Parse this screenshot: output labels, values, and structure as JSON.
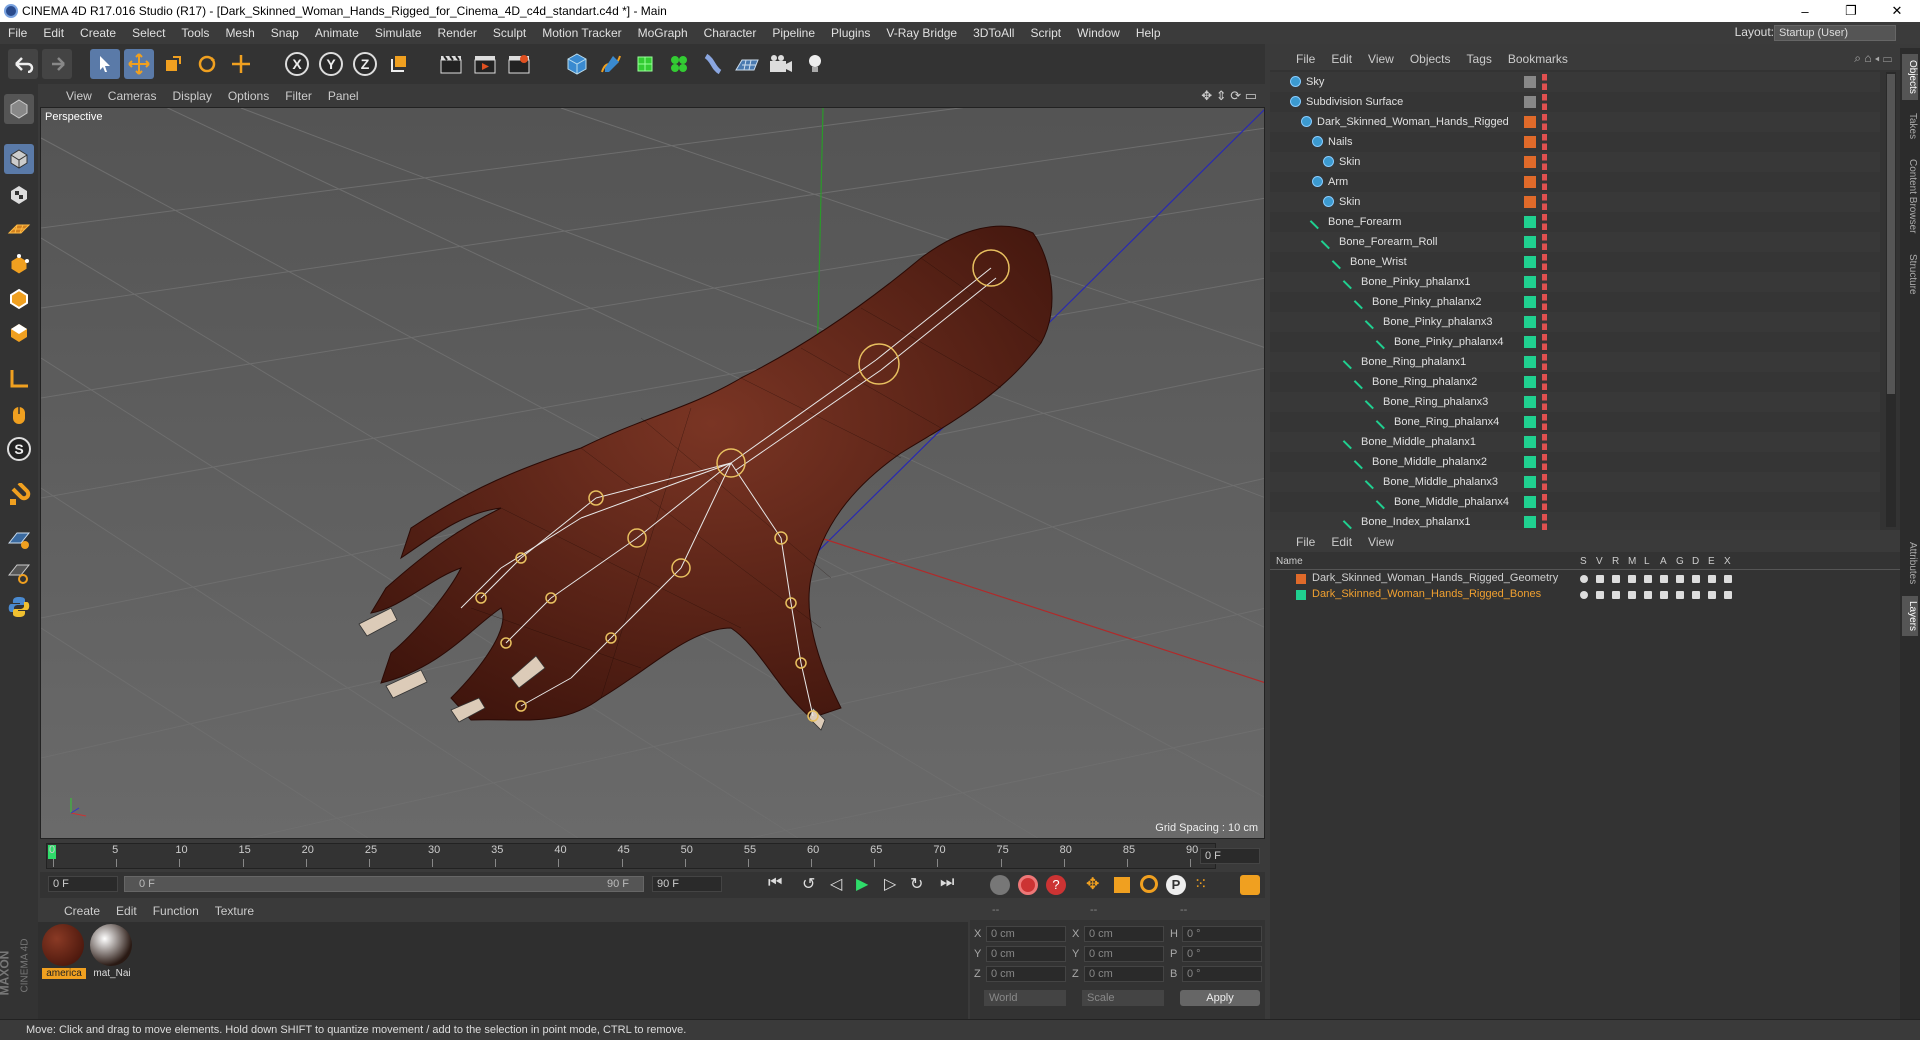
{
  "window": {
    "title": "CINEMA 4D R17.016 Studio (R17) - [Dark_Skinned_Woman_Hands_Rigged_for_Cinema_4D_c4d_standart.c4d *] - Main",
    "minimize": "–",
    "maximize": "❐",
    "close": "✕"
  },
  "menu": [
    "File",
    "Edit",
    "Create",
    "Select",
    "Tools",
    "Mesh",
    "Snap",
    "Animate",
    "Simulate",
    "Render",
    "Sculpt",
    "Motion Tracker",
    "MoGraph",
    "Character",
    "Pipeline",
    "Plugins",
    "V-Ray Bridge",
    "3DToAll",
    "Script",
    "Window",
    "Help"
  ],
  "layout": {
    "label": "Layout:",
    "value": "Startup (User)"
  },
  "viewport": {
    "menu": [
      "View",
      "Cameras",
      "Display",
      "Options",
      "Filter",
      "Panel"
    ],
    "label": "Perspective",
    "grid_spacing": "Grid Spacing : 10 cm"
  },
  "timeline": {
    "ticks": [
      "0",
      "5",
      "10",
      "15",
      "20",
      "25",
      "30",
      "35",
      "40",
      "45",
      "50",
      "55",
      "60",
      "65",
      "70",
      "75",
      "80",
      "85",
      "90"
    ],
    "current": "0 F",
    "start": "0 F",
    "range_start": "0 F",
    "range_end": "90 F",
    "end": "90 F"
  },
  "material_manager": {
    "menu": [
      "Create",
      "Edit",
      "Function",
      "Texture"
    ],
    "materials": [
      {
        "name": "america",
        "color": "#5a1e12"
      },
      {
        "name": "mat_Nai",
        "color": "#e8e0d8"
      }
    ]
  },
  "coordinates": {
    "header": [
      "--",
      "--",
      "--"
    ],
    "rows": [
      {
        "a": "X",
        "av": "0 cm",
        "b": "X",
        "bv": "0 cm",
        "c": "H",
        "cv": "0 °"
      },
      {
        "a": "Y",
        "av": "0 cm",
        "b": "Y",
        "bv": "0 cm",
        "c": "P",
        "cv": "0 °"
      },
      {
        "a": "Z",
        "av": "0 cm",
        "b": "Z",
        "bv": "0 cm",
        "c": "B",
        "cv": "0 °"
      }
    ],
    "world": "World",
    "scale": "Scale",
    "apply": "Apply"
  },
  "object_manager": {
    "menu": [
      "File",
      "Edit",
      "View",
      "Objects",
      "Tags",
      "Bookmarks"
    ],
    "objects": [
      {
        "name": "Sky",
        "indent": 0,
        "color": "#888888"
      },
      {
        "name": "Subdivision Surface",
        "indent": 0,
        "color": "#888888"
      },
      {
        "name": "Dark_Skinned_Woman_Hands_Rigged",
        "indent": 1,
        "color": "#e06a2a"
      },
      {
        "name": "Nails",
        "indent": 2,
        "color": "#e06a2a"
      },
      {
        "name": "Skin",
        "indent": 3,
        "color": "#e06a2a"
      },
      {
        "name": "Arm",
        "indent": 2,
        "color": "#e06a2a"
      },
      {
        "name": "Skin",
        "indent": 3,
        "color": "#e06a2a"
      },
      {
        "name": "Bone_Forearm",
        "indent": 2,
        "color": "#20d090"
      },
      {
        "name": "Bone_Forearm_Roll",
        "indent": 3,
        "color": "#20d090"
      },
      {
        "name": "Bone_Wrist",
        "indent": 4,
        "color": "#20d090"
      },
      {
        "name": "Bone_Pinky_phalanx1",
        "indent": 5,
        "color": "#20d090"
      },
      {
        "name": "Bone_Pinky_phalanx2",
        "indent": 6,
        "color": "#20d090"
      },
      {
        "name": "Bone_Pinky_phalanx3",
        "indent": 7,
        "color": "#20d090"
      },
      {
        "name": "Bone_Pinky_phalanx4",
        "indent": 8,
        "color": "#20d090"
      },
      {
        "name": "Bone_Ring_phalanx1",
        "indent": 5,
        "color": "#20d090"
      },
      {
        "name": "Bone_Ring_phalanx2",
        "indent": 6,
        "color": "#20d090"
      },
      {
        "name": "Bone_Ring_phalanx3",
        "indent": 7,
        "color": "#20d090"
      },
      {
        "name": "Bone_Ring_phalanx4",
        "indent": 8,
        "color": "#20d090"
      },
      {
        "name": "Bone_Middle_phalanx1",
        "indent": 5,
        "color": "#20d090"
      },
      {
        "name": "Bone_Middle_phalanx2",
        "indent": 6,
        "color": "#20d090"
      },
      {
        "name": "Bone_Middle_phalanx3",
        "indent": 7,
        "color": "#20d090"
      },
      {
        "name": "Bone_Middle_phalanx4",
        "indent": 8,
        "color": "#20d090"
      },
      {
        "name": "Bone_Index_phalanx1",
        "indent": 5,
        "color": "#20d090"
      }
    ]
  },
  "layer_manager": {
    "menu": [
      "File",
      "Edit",
      "View"
    ],
    "columns": [
      "Name",
      "S",
      "V",
      "R",
      "M",
      "L",
      "A",
      "G",
      "D",
      "E",
      "X"
    ],
    "layers": [
      {
        "name": "Dark_Skinned_Woman_Hands_Rigged_Geometry",
        "color": "#e06a2a",
        "text_color": "#d0d0d0"
      },
      {
        "name": "Dark_Skinned_Woman_Hands_Rigged_Bones",
        "color": "#20d090",
        "text_color": "#f0a030"
      }
    ]
  },
  "right_tabs": [
    "Objects",
    "Takes",
    "Content Browser",
    "Structure",
    "Attributes",
    "Layers"
  ],
  "status": "Move: Click and drag to move elements. Hold down SHIFT to quantize movement / add to the selection in point mode, CTRL to remove.",
  "brand": {
    "line1": "MAXON",
    "line2": "CINEMA 4D"
  }
}
